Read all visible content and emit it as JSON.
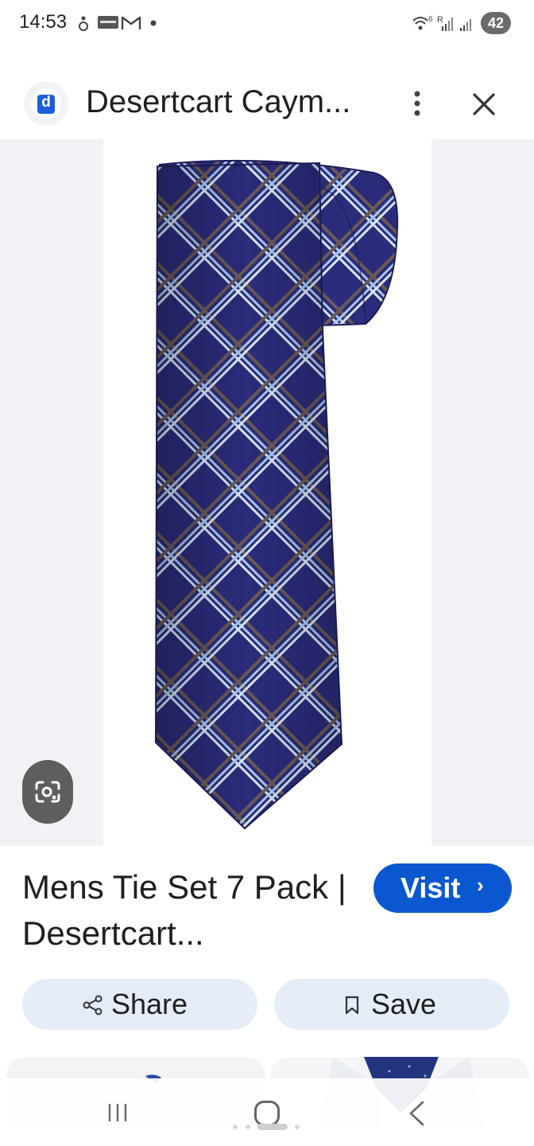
{
  "status_bar": {
    "time": "14:53",
    "battery": "42",
    "icons": [
      "notification-icon",
      "news-app-icon",
      "gmail-icon",
      "dot-icon",
      "wifi-icon",
      "signal-roaming-icon",
      "signal-icon"
    ]
  },
  "header": {
    "site_name": "Desertcart Caym...",
    "logo_letter": "d",
    "icons": [
      "more-vert-icon",
      "close-icon"
    ]
  },
  "result": {
    "title": "Mens Tie Set 7 Pack | Desertcart...",
    "visit_label": "Visit",
    "share_label": "Share",
    "save_label": "Save"
  },
  "colors": {
    "accent": "#0b57d0",
    "action_bg": "#e4ecf8",
    "tie_base": "#2b2c7a",
    "tie_stripe": "#a9c8ec"
  }
}
